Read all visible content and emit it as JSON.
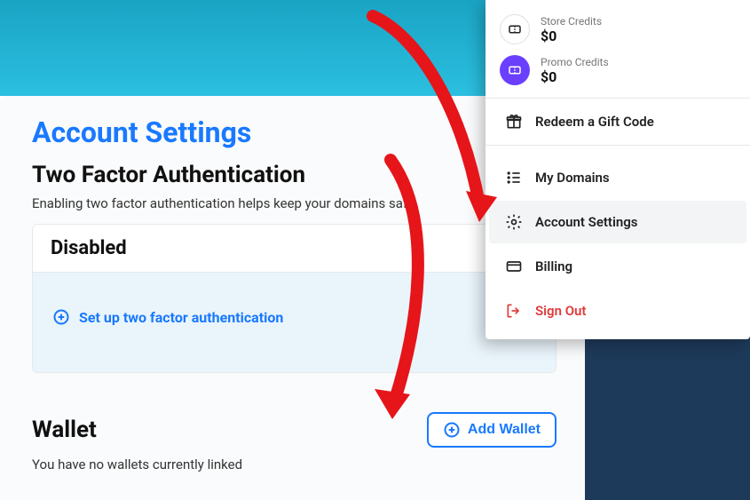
{
  "page": {
    "title": "Account Settings"
  },
  "tfa": {
    "title": "Two Factor Authentication",
    "description": "Enabling two factor authentication helps keep your domains safe.",
    "status": "Disabled",
    "setup_link": "Set up two factor authentication"
  },
  "wallet": {
    "title": "Wallet",
    "add_button": "Add Wallet",
    "empty_text": "You have no wallets currently linked"
  },
  "dropdown": {
    "credits": {
      "store": {
        "label": "Store Credits",
        "value": "$0"
      },
      "promo": {
        "label": "Promo Credits",
        "value": "$0"
      }
    },
    "redeem": "Redeem a Gift Code",
    "items": {
      "my_domains": "My Domains",
      "account_settings": "Account Settings",
      "billing": "Billing",
      "sign_out": "Sign Out"
    }
  }
}
